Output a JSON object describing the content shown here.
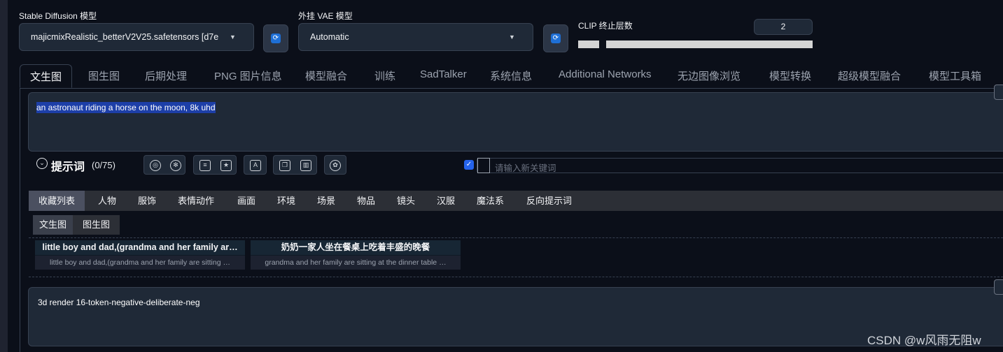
{
  "model": {
    "label": "Stable Diffusion 模型",
    "value": "majicmixRealistic_betterV2V25.safetensors [d7e"
  },
  "vae": {
    "label": "外挂 VAE 模型",
    "value": "Automatic"
  },
  "clip": {
    "label": "CLIP 终止层数",
    "value": "2"
  },
  "tabs": [
    "文生图",
    "图生图",
    "后期处理",
    "PNG 图片信息",
    "模型融合",
    "训练",
    "SadTalker",
    "系统信息",
    "Additional Networks",
    "无边图像浏览",
    "模型转换",
    "超级模型融合",
    "模型工具箱"
  ],
  "prompt": {
    "text": "an astronaut riding a horse on the moon, 8k uhd"
  },
  "prompt_bar": {
    "title": "提示词",
    "count": "(0/75)",
    "keyword_placeholder": "请输入新关键词"
  },
  "categories": [
    "收藏列表",
    "人物",
    "服饰",
    "表情动作",
    "画面",
    "环境",
    "场景",
    "物品",
    "镜头",
    "汉服",
    "魔法系",
    "反向提示词"
  ],
  "subtabs": [
    "文生图",
    "图生图"
  ],
  "cards": [
    {
      "title": "little boy and dad,(grandma and her family ar…",
      "desc": "little boy and dad,(grandma and her family are sitting …"
    },
    {
      "title": "奶奶一家人坐在餐桌上吃着丰盛的晚餐",
      "desc": "grandma and her family are sitting at the dinner table …"
    }
  ],
  "negative": {
    "text": "3d render  16-token-negative-deliberate-neg"
  },
  "watermark": "CSDN @w风雨无阻w",
  "colors": {
    "background": "#0b0f19",
    "panel": "#1f2937",
    "accent": "#2563eb",
    "selection": "#1d3fa8"
  }
}
